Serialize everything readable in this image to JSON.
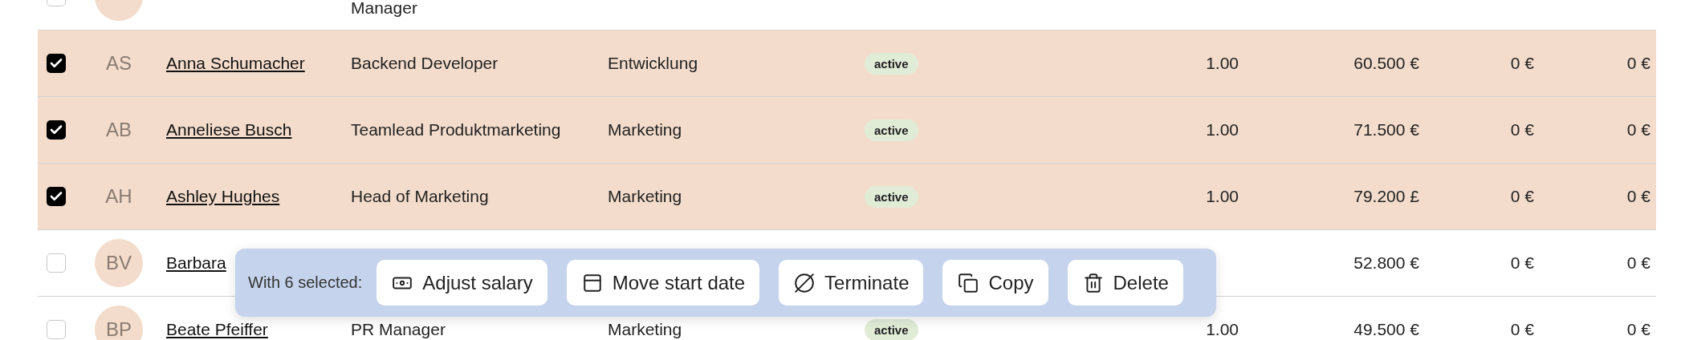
{
  "rows": [
    {
      "selected": false,
      "title": "Manager"
    },
    {
      "selected": true,
      "avatar": "AS",
      "name": "Anna Schumacher",
      "title": "Backend Developer",
      "department": "Entwicklung",
      "status": "active",
      "fte": "1.00",
      "salary": "60.500 €",
      "col_8": "0 €",
      "col_9": "0 €"
    },
    {
      "selected": true,
      "avatar": "AB",
      "name": "Anneliese Busch",
      "title": "Teamlead Produktmarketing",
      "department": "Marketing",
      "status": "active",
      "fte": "1.00",
      "salary": "71.500 €",
      "col_8": "0 €",
      "col_9": "0 €"
    },
    {
      "selected": true,
      "avatar": "AH",
      "name": "Ashley Hughes",
      "title": "Head of Marketing",
      "department": "Marketing",
      "status": "active",
      "fte": "1.00",
      "salary": "79.200 £",
      "col_8": "0 €",
      "col_9": "0 €"
    },
    {
      "selected": false,
      "avatar": "BV",
      "name": "Barbara",
      "salary": "52.800 €",
      "col_8": "0 €",
      "col_9": "0 €"
    },
    {
      "selected": false,
      "avatar": "BP",
      "name": "Beate Pfeiffer",
      "title": "PR Manager",
      "department": "Marketing",
      "status": "active",
      "fte": "1.00",
      "salary": "49.500 €",
      "col_8": "0 €",
      "col_9": "0 €"
    }
  ],
  "bulk_bar": {
    "label": "With 6 selected:",
    "actions": [
      {
        "kind": "salary",
        "label": "Adjust salary"
      },
      {
        "kind": "date",
        "label": "Move start date"
      },
      {
        "kind": "terminate",
        "label": "Terminate"
      },
      {
        "kind": "copy",
        "label": "Copy"
      },
      {
        "kind": "delete",
        "label": "Delete"
      }
    ]
  }
}
